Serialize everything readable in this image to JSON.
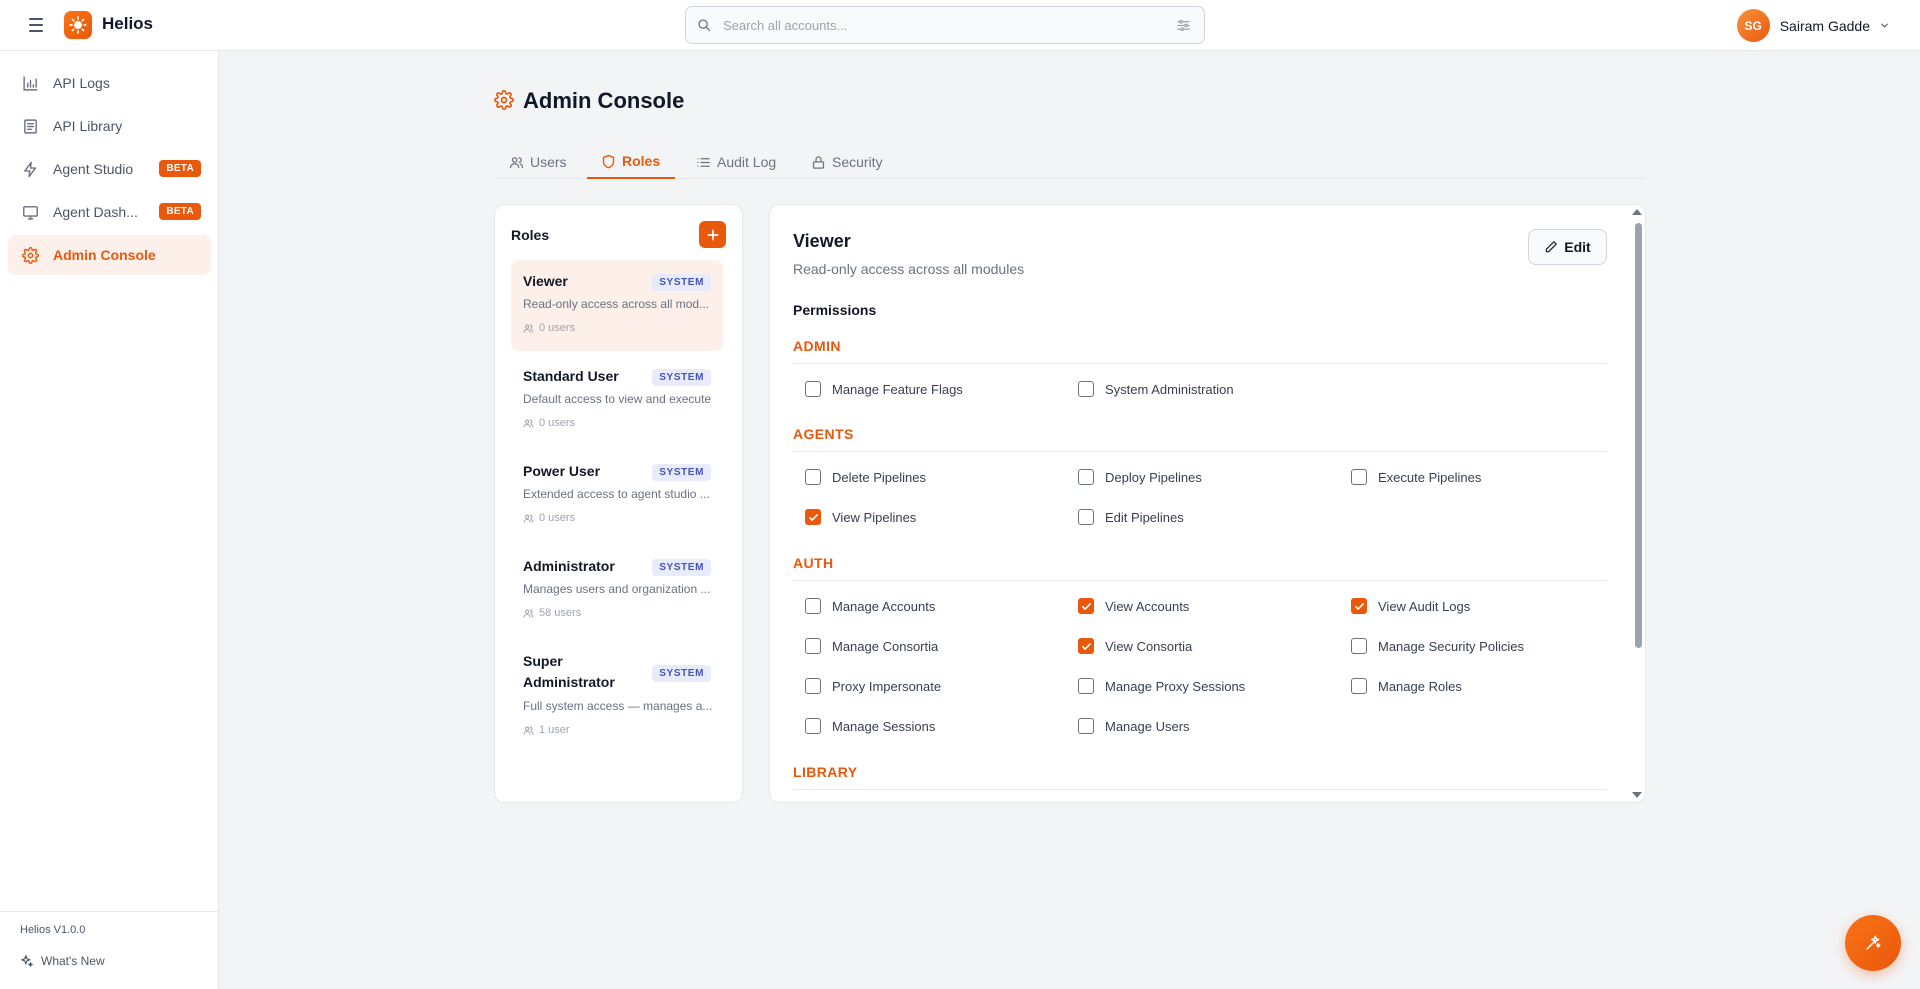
{
  "app": {
    "name": "Helios",
    "version": "Helios V1.0.0"
  },
  "search": {
    "placeholder": "Search all accounts..."
  },
  "user": {
    "initials": "SG",
    "name": "Sairam Gadde"
  },
  "sidebar": {
    "items": [
      {
        "label": "API Logs",
        "icon": "bar-chart-icon"
      },
      {
        "label": "API Library",
        "icon": "book-icon"
      },
      {
        "label": "Agent Studio",
        "icon": "lightning-icon",
        "badge": "BETA"
      },
      {
        "label": "Agent Dash...",
        "icon": "monitor-icon",
        "badge": "BETA"
      },
      {
        "label": "Admin Console",
        "icon": "gear-icon",
        "active": true
      }
    ],
    "whats_new": "What's New"
  },
  "page": {
    "title": "Admin Console"
  },
  "tabs": [
    {
      "label": "Users"
    },
    {
      "label": "Roles",
      "active": true
    },
    {
      "label": "Audit Log"
    },
    {
      "label": "Security"
    }
  ],
  "roles_panel": {
    "title": "Roles",
    "roles": [
      {
        "name": "Viewer",
        "badge": "SYSTEM",
        "description": "Read-only access across all mod...",
        "users": "0 users",
        "active": true
      },
      {
        "name": "Standard User",
        "badge": "SYSTEM",
        "description": "Default access to view and execute",
        "users": "0 users"
      },
      {
        "name": "Power User",
        "badge": "SYSTEM",
        "description": "Extended access to agent studio ...",
        "users": "0 users"
      },
      {
        "name": "Administrator",
        "badge": "SYSTEM",
        "description": "Manages users and organization ...",
        "users": "58 users"
      },
      {
        "name": "Super Administrator",
        "badge": "SYSTEM",
        "description": "Full system access — manages a...",
        "users": "1 user"
      }
    ]
  },
  "detail": {
    "title": "Viewer",
    "description": "Read-only access across all modules",
    "edit_label": "Edit",
    "permissions_label": "Permissions",
    "sections": [
      {
        "name": "ADMIN",
        "permissions": [
          {
            "label": "Manage Feature Flags",
            "checked": false
          },
          {
            "label": "System Administration",
            "checked": false
          }
        ]
      },
      {
        "name": "AGENTS",
        "permissions": [
          {
            "label": "Delete Pipelines",
            "checked": false
          },
          {
            "label": "Deploy Pipelines",
            "checked": false
          },
          {
            "label": "Execute Pipelines",
            "checked": false
          },
          {
            "label": "View Pipelines",
            "checked": true
          },
          {
            "label": "Edit Pipelines",
            "checked": false
          }
        ]
      },
      {
        "name": "AUTH",
        "permissions": [
          {
            "label": "Manage Accounts",
            "checked": false
          },
          {
            "label": "View Accounts",
            "checked": true
          },
          {
            "label": "View Audit Logs",
            "checked": true
          },
          {
            "label": "Manage Consortia",
            "checked": false
          },
          {
            "label": "View Consortia",
            "checked": true
          },
          {
            "label": "Manage Security Policies",
            "checked": false
          },
          {
            "label": "Proxy Impersonate",
            "checked": false
          },
          {
            "label": "Manage Proxy Sessions",
            "checked": false
          },
          {
            "label": "Manage Roles",
            "checked": false
          },
          {
            "label": "Manage Sessions",
            "checked": false
          },
          {
            "label": "Manage Users",
            "checked": false
          }
        ]
      },
      {
        "name": "LIBRARY",
        "permissions": []
      }
    ]
  },
  "colors": {
    "accent": "#ea580c",
    "badge_bg": "#e8ebfb",
    "badge_text": "#4654b5"
  }
}
